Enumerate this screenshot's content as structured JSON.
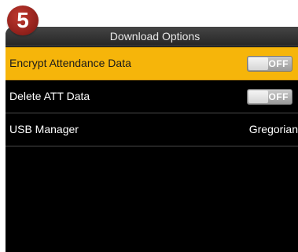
{
  "step_badge": "5",
  "title": "Download Options",
  "items": [
    {
      "label": "Encrypt Attendance Data",
      "toggle": "OFF",
      "selected": true
    },
    {
      "label": "Delete ATT Data",
      "toggle": "OFF",
      "selected": false
    },
    {
      "label": "USB Manager",
      "value": "Gregorian",
      "selected": false
    }
  ],
  "colors": {
    "selected_row": "#f6b50a",
    "screen_bg": "#000000",
    "badge": "#a3261f"
  }
}
